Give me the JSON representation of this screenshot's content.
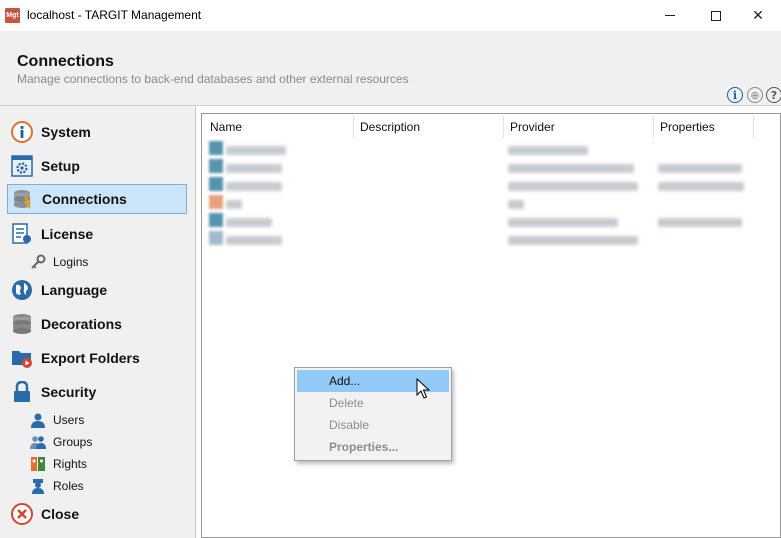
{
  "window": {
    "title": "localhost - TARGIT Management",
    "app_icon_text": "Mgt"
  },
  "header": {
    "title": "Connections",
    "subtitle": "Manage connections to back-end databases and other external resources"
  },
  "sidebar": {
    "items": [
      {
        "label": "System",
        "icon": "info-circle-icon",
        "selected": false
      },
      {
        "label": "Setup",
        "icon": "gear-window-icon",
        "selected": false
      },
      {
        "label": "Connections",
        "icon": "database-connection-icon",
        "selected": true
      },
      {
        "label": "License",
        "icon": "license-document-icon",
        "selected": false
      },
      {
        "label": "Language",
        "icon": "globe-icon",
        "selected": false
      },
      {
        "label": "Decorations",
        "icon": "database-stack-icon",
        "selected": false
      },
      {
        "label": "Export Folders",
        "icon": "folder-play-icon",
        "selected": false
      },
      {
        "label": "Security",
        "icon": "padlock-icon",
        "selected": false
      },
      {
        "label": "Close",
        "icon": "close-circle-icon",
        "selected": false
      }
    ],
    "sub_items": {
      "license": [
        {
          "label": "Logins",
          "icon": "key-icon"
        }
      ],
      "security": [
        {
          "label": "Users",
          "icon": "user-icon"
        },
        {
          "label": "Groups",
          "icon": "group-icon"
        },
        {
          "label": "Rights",
          "icon": "rights-icon"
        },
        {
          "label": "Roles",
          "icon": "role-icon"
        }
      ]
    }
  },
  "table": {
    "columns": [
      "Name",
      "Description",
      "Provider",
      "Properties"
    ]
  },
  "context_menu": {
    "items": [
      {
        "label": "Add...",
        "enabled": true,
        "highlighted": true
      },
      {
        "label": "Delete",
        "enabled": false
      },
      {
        "label": "Disable",
        "enabled": false
      },
      {
        "label": "Properties...",
        "enabled": false,
        "bold": true
      }
    ]
  },
  "colors": {
    "selection": "#cce4f7",
    "menu_highlight": "#91c9f7",
    "accent_blue": "#1a5fa8",
    "close_red": "#d6452f"
  }
}
